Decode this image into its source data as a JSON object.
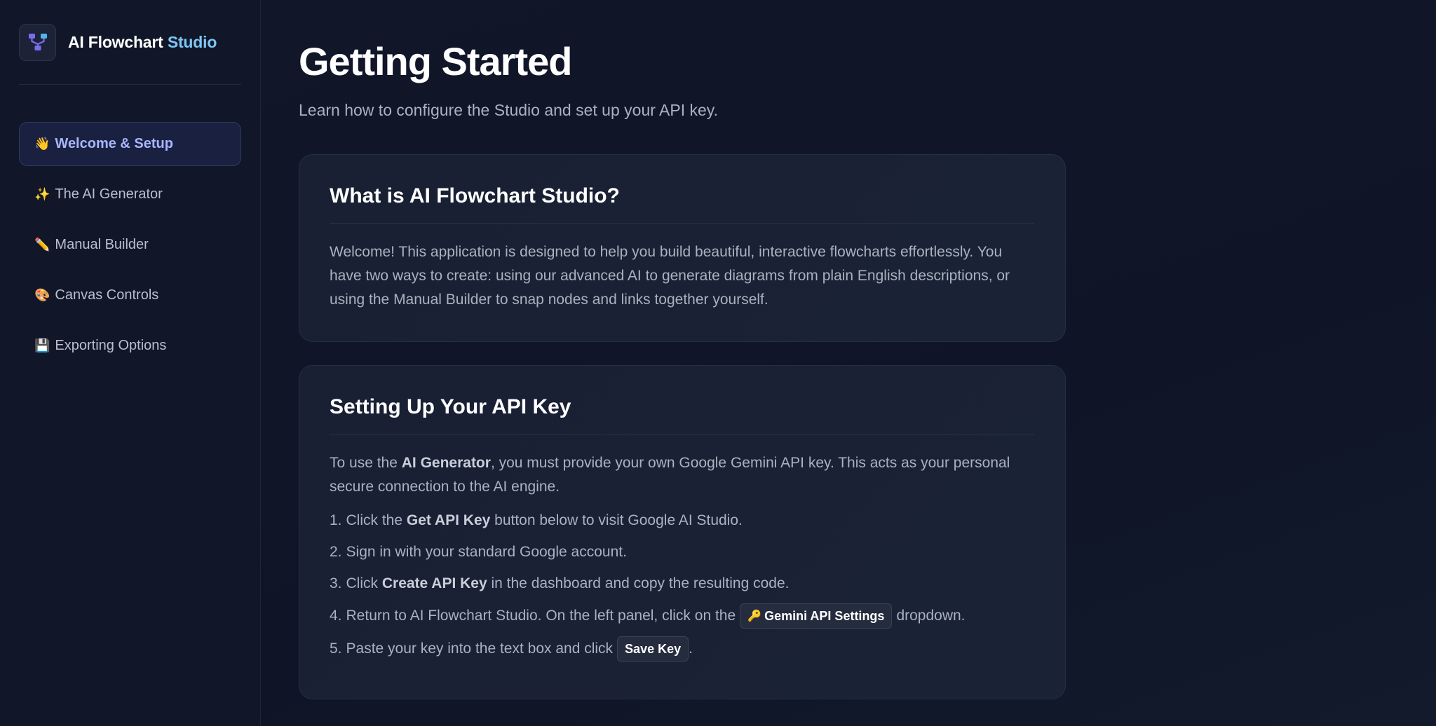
{
  "brand": {
    "name": "AI Flowchart",
    "accent": "Studio"
  },
  "sidebar": {
    "items": [
      {
        "emoji": "👋",
        "label": "Welcome & Setup",
        "active": true
      },
      {
        "emoji": "✨",
        "label": "The AI Generator",
        "active": false
      },
      {
        "emoji": "✏️",
        "label": "Manual Builder",
        "active": false
      },
      {
        "emoji": "🎨",
        "label": "Canvas Controls",
        "active": false
      },
      {
        "emoji": "💾",
        "label": "Exporting Options",
        "active": false
      }
    ]
  },
  "page": {
    "title": "Getting Started",
    "subtitle": "Learn how to configure the Studio and set up your API key."
  },
  "card1": {
    "title": "What is AI Flowchart Studio?",
    "body": "Welcome! This application is designed to help you build beautiful, interactive flowcharts effortlessly. You have two ways to create: using our advanced AI to generate diagrams from plain English descriptions, or using the Manual Builder to snap nodes and links together yourself."
  },
  "card2": {
    "title": "Setting Up Your API Key",
    "intro_pre": "To use the ",
    "intro_bold": "AI Generator",
    "intro_post": ", you must provide your own Google Gemini API key. This acts as your personal secure connection to the AI engine.",
    "steps": [
      {
        "num": "1.",
        "pre": "Click the ",
        "bold": "Get API Key",
        "post": " button below to visit Google AI Studio."
      },
      {
        "num": "2.",
        "pre": "Sign in with your standard Google account.",
        "bold": "",
        "post": ""
      },
      {
        "num": "3.",
        "pre": "Click ",
        "bold": "Create API Key",
        "post": " in the dashboard and copy the resulting code."
      },
      {
        "num": "4.",
        "pre": "Return to AI Flowchart Studio. On the left panel, click on the ",
        "chip_emoji": "🔑",
        "chip": "Gemini API Settings",
        "post": " dropdown."
      },
      {
        "num": "5.",
        "pre": "Paste your key into the text box and click ",
        "chip": "Save Key",
        "post": "."
      }
    ]
  },
  "colors": {
    "accent": "#7cc7f7",
    "active_nav": "#a9b6ff",
    "background": "#0f1424"
  }
}
